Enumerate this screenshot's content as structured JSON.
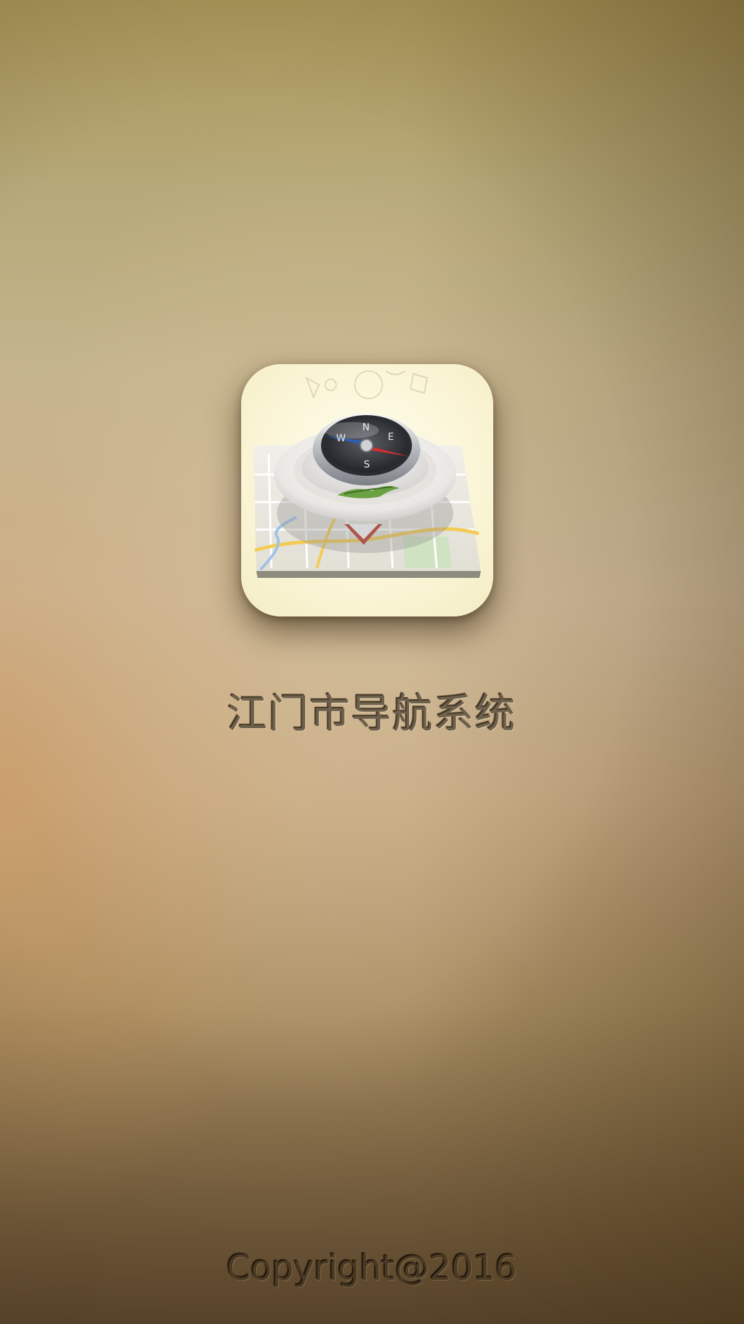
{
  "splash": {
    "icon": "compass-map-icon",
    "title": "江门市导航系统",
    "copyright": "Copyright@2016"
  }
}
